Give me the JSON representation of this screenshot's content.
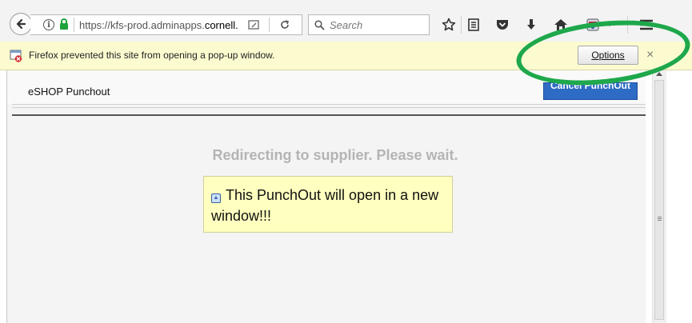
{
  "browser": {
    "url_prefix": "https://kfs-prod.adminapps.",
    "url_host": "cornell.",
    "search_placeholder": "Search"
  },
  "notification": {
    "message": "Firefox prevented this site from opening a pop-up window.",
    "options_label": "Options",
    "close_label": "×"
  },
  "page": {
    "title": "eSHOP Punchout",
    "cancel_label": "Cancel PunchOut",
    "redirect_message": "Redirecting to supplier. Please wait.",
    "popup_message": "This PunchOut will open in a new window!!!"
  },
  "colors": {
    "annotation_oval": "#1ea84b",
    "cancel_button": "#2d6bc4",
    "notification_bg": "#fcfbd0",
    "popup_bg": "#ffffbf"
  },
  "icons": {
    "toolbar": [
      "back-arrow-icon",
      "info-icon",
      "lock-icon",
      "reader-view-icon",
      "reload-icon",
      "search-icon",
      "bookmark-star-icon",
      "reading-list-icon",
      "pocket-icon",
      "download-icon",
      "home-icon",
      "addon-icon",
      "overflow-chevron-icon",
      "hamburger-menu-icon"
    ],
    "notification": [
      "popup-blocked-icon",
      "close-icon"
    ],
    "page": [
      "info-tip-icon"
    ]
  }
}
